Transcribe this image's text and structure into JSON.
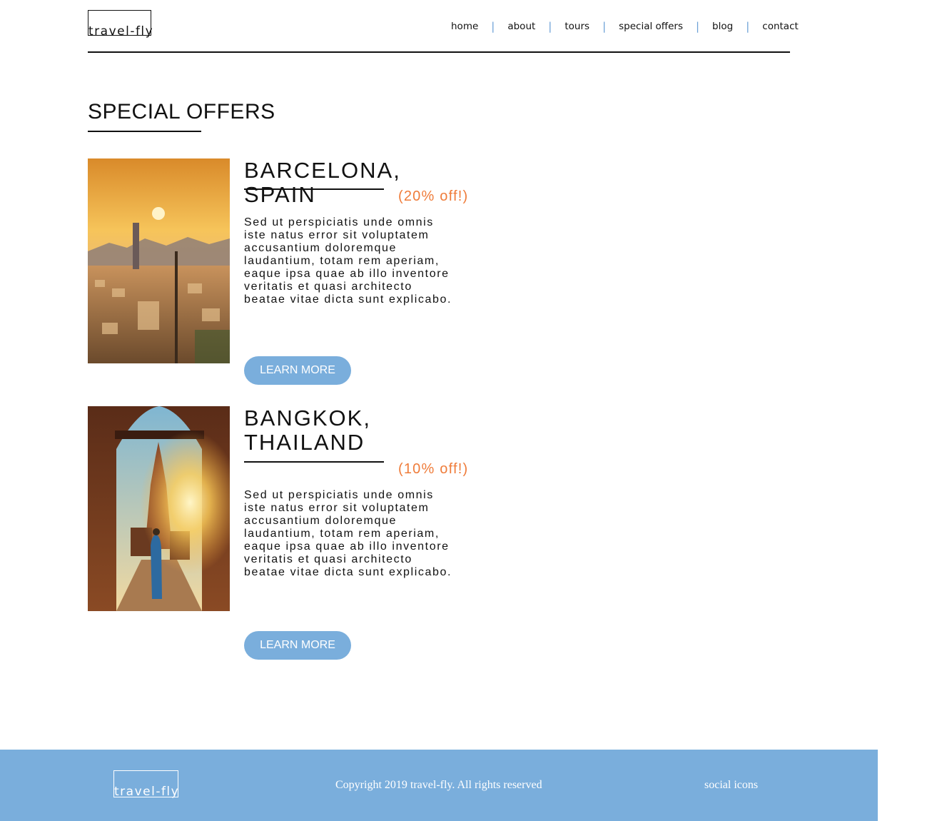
{
  "header": {
    "logo_text": "travel-fly",
    "nav": [
      {
        "label": "home"
      },
      {
        "label": "about"
      },
      {
        "label": "tours"
      },
      {
        "label": "special offers"
      },
      {
        "label": "blog"
      },
      {
        "label": "contact"
      }
    ],
    "nav_separator": "|"
  },
  "page": {
    "title": "SPECIAL OFFERS"
  },
  "offers": [
    {
      "title": "BARCELONA, SPAIN",
      "discount": "(20% off!)",
      "description": "Sed ut perspiciatis unde omnis iste natus error sit voluptatem accusantium doloremque laudantium, totam rem aperiam, eaque ipsa quae ab illo inventore veritatis et quasi architecto beatae vitae dicta sunt explicabo.",
      "button_label": "LEARN MORE"
    },
    {
      "title": "BANGKOK, THAILAND",
      "discount": "(10% off!)",
      "description": "Sed ut perspiciatis unde omnis iste natus error sit voluptatem accusantium doloremque laudantium, totam rem aperiam, eaque ipsa quae ab illo inventore veritatis et quasi architecto beatae vitae dicta sunt explicabo.",
      "button_label": "LEARN MORE"
    }
  ],
  "footer": {
    "logo_text": "travel-fly",
    "copyright": "Copyright 2019 travel-fly. All rights reserved",
    "social": "social icons"
  },
  "colors": {
    "accent": "#7aaedc",
    "discount": "#ef7c3a",
    "separator": "#6a9fd6"
  }
}
